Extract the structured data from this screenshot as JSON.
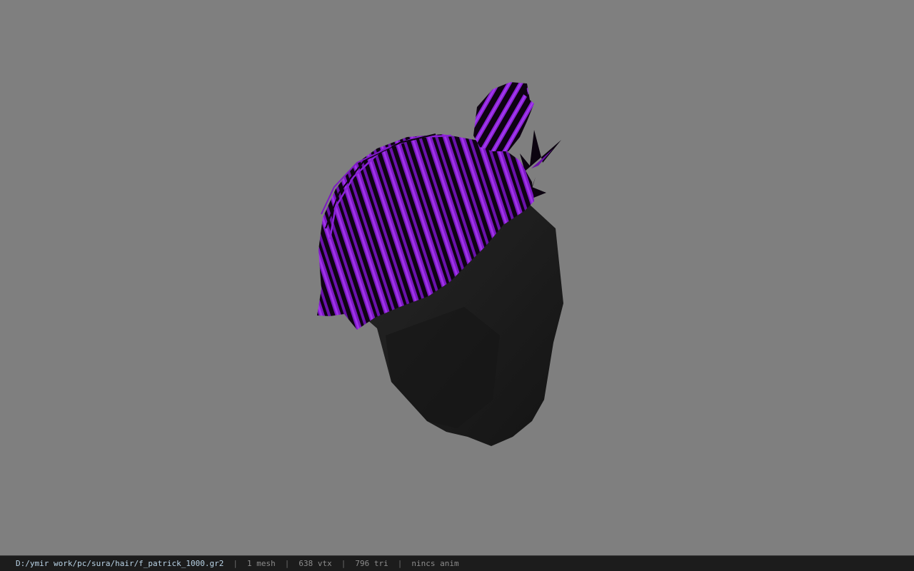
{
  "viewer": {
    "background_color": "#7f7f7f",
    "model": {
      "name": "hair-mesh",
      "hair_color": "#8b1fd1",
      "face_color": "#1e1e1e"
    }
  },
  "statusbar": {
    "file_path": "D:/ymir work/pc/sura/hair/f_patrick_1000.gr2",
    "mesh_count": "1 mesh",
    "vertex_count": "638 vtx",
    "triangle_count": "796 tri",
    "anim_status": "nincs anim",
    "separator": "|"
  }
}
